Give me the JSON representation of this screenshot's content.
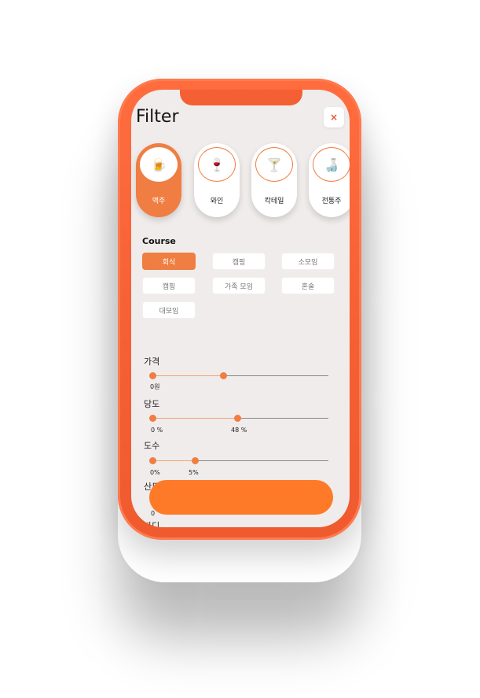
{
  "header": {
    "title": "Filter",
    "close_label": "×"
  },
  "drinks": [
    {
      "label": "맥주",
      "icon": "🍺",
      "icon_name": "beer-icon",
      "active": true
    },
    {
      "label": "와인",
      "icon": "🍷",
      "icon_name": "wine-icon",
      "active": false
    },
    {
      "label": "칵테일",
      "icon": "🍸",
      "icon_name": "cocktail-icon",
      "active": false
    },
    {
      "label": "전통주",
      "icon": "🍶",
      "icon_name": "sake-icon",
      "active": false
    }
  ],
  "course": {
    "title": "Course",
    "chips": [
      {
        "label": "회식",
        "active": true
      },
      {
        "label": "캠핑",
        "active": false
      },
      {
        "label": "소모임",
        "active": false
      },
      {
        "label": "캠핑",
        "active": false
      },
      {
        "label": "가족 모임",
        "active": false
      },
      {
        "label": "혼술",
        "active": false
      },
      {
        "label": "대모임",
        "active": false
      }
    ]
  },
  "sliders": [
    {
      "title": "가격",
      "min_label": "0원",
      "max_label": "",
      "min_value": 0,
      "max_value": 40
    },
    {
      "title": "당도",
      "min_label": "0 %",
      "max_label": "48 %",
      "min_value": 0,
      "max_value": 48
    },
    {
      "title": "도수",
      "min_label": "0%",
      "max_label": "5%",
      "min_value": 0,
      "max_value": 24
    },
    {
      "title": "산도",
      "min_label": "0",
      "max_label": "",
      "min_value": 0,
      "max_value": 50
    }
  ],
  "partial_label": "바디",
  "apply_button": {
    "label": ""
  },
  "colors": {
    "accent": "#f07d41",
    "phone_frame": "#f45f33",
    "screen_bg": "#f0eceb",
    "button": "#ff7a28"
  }
}
